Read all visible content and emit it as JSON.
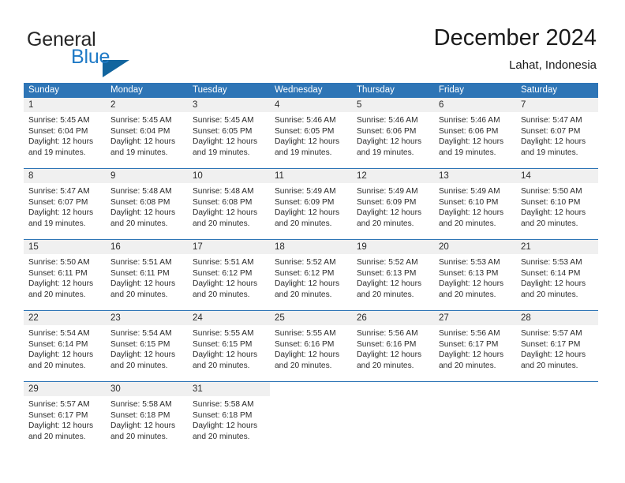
{
  "brand": {
    "name_part1": "General",
    "name_part2": "Blue",
    "accent_color": "#1f7ac6",
    "triangle_color": "#12659e"
  },
  "header": {
    "title": "December 2024",
    "location": "Lahat, Indonesia"
  },
  "colors": {
    "header_blue": "#2e75b6",
    "daynum_band": "#f0f0f0",
    "text": "#2b2b2b"
  },
  "weekdays": [
    "Sunday",
    "Monday",
    "Tuesday",
    "Wednesday",
    "Thursday",
    "Friday",
    "Saturday"
  ],
  "weeks": [
    [
      {
        "day": "1",
        "sunrise": "Sunrise: 5:45 AM",
        "sunset": "Sunset: 6:04 PM",
        "daylight1": "Daylight: 12 hours",
        "daylight2": "and 19 minutes."
      },
      {
        "day": "2",
        "sunrise": "Sunrise: 5:45 AM",
        "sunset": "Sunset: 6:04 PM",
        "daylight1": "Daylight: 12 hours",
        "daylight2": "and 19 minutes."
      },
      {
        "day": "3",
        "sunrise": "Sunrise: 5:45 AM",
        "sunset": "Sunset: 6:05 PM",
        "daylight1": "Daylight: 12 hours",
        "daylight2": "and 19 minutes."
      },
      {
        "day": "4",
        "sunrise": "Sunrise: 5:46 AM",
        "sunset": "Sunset: 6:05 PM",
        "daylight1": "Daylight: 12 hours",
        "daylight2": "and 19 minutes."
      },
      {
        "day": "5",
        "sunrise": "Sunrise: 5:46 AM",
        "sunset": "Sunset: 6:06 PM",
        "daylight1": "Daylight: 12 hours",
        "daylight2": "and 19 minutes."
      },
      {
        "day": "6",
        "sunrise": "Sunrise: 5:46 AM",
        "sunset": "Sunset: 6:06 PM",
        "daylight1": "Daylight: 12 hours",
        "daylight2": "and 19 minutes."
      },
      {
        "day": "7",
        "sunrise": "Sunrise: 5:47 AM",
        "sunset": "Sunset: 6:07 PM",
        "daylight1": "Daylight: 12 hours",
        "daylight2": "and 19 minutes."
      }
    ],
    [
      {
        "day": "8",
        "sunrise": "Sunrise: 5:47 AM",
        "sunset": "Sunset: 6:07 PM",
        "daylight1": "Daylight: 12 hours",
        "daylight2": "and 19 minutes."
      },
      {
        "day": "9",
        "sunrise": "Sunrise: 5:48 AM",
        "sunset": "Sunset: 6:08 PM",
        "daylight1": "Daylight: 12 hours",
        "daylight2": "and 20 minutes."
      },
      {
        "day": "10",
        "sunrise": "Sunrise: 5:48 AM",
        "sunset": "Sunset: 6:08 PM",
        "daylight1": "Daylight: 12 hours",
        "daylight2": "and 20 minutes."
      },
      {
        "day": "11",
        "sunrise": "Sunrise: 5:49 AM",
        "sunset": "Sunset: 6:09 PM",
        "daylight1": "Daylight: 12 hours",
        "daylight2": "and 20 minutes."
      },
      {
        "day": "12",
        "sunrise": "Sunrise: 5:49 AM",
        "sunset": "Sunset: 6:09 PM",
        "daylight1": "Daylight: 12 hours",
        "daylight2": "and 20 minutes."
      },
      {
        "day": "13",
        "sunrise": "Sunrise: 5:49 AM",
        "sunset": "Sunset: 6:10 PM",
        "daylight1": "Daylight: 12 hours",
        "daylight2": "and 20 minutes."
      },
      {
        "day": "14",
        "sunrise": "Sunrise: 5:50 AM",
        "sunset": "Sunset: 6:10 PM",
        "daylight1": "Daylight: 12 hours",
        "daylight2": "and 20 minutes."
      }
    ],
    [
      {
        "day": "15",
        "sunrise": "Sunrise: 5:50 AM",
        "sunset": "Sunset: 6:11 PM",
        "daylight1": "Daylight: 12 hours",
        "daylight2": "and 20 minutes."
      },
      {
        "day": "16",
        "sunrise": "Sunrise: 5:51 AM",
        "sunset": "Sunset: 6:11 PM",
        "daylight1": "Daylight: 12 hours",
        "daylight2": "and 20 minutes."
      },
      {
        "day": "17",
        "sunrise": "Sunrise: 5:51 AM",
        "sunset": "Sunset: 6:12 PM",
        "daylight1": "Daylight: 12 hours",
        "daylight2": "and 20 minutes."
      },
      {
        "day": "18",
        "sunrise": "Sunrise: 5:52 AM",
        "sunset": "Sunset: 6:12 PM",
        "daylight1": "Daylight: 12 hours",
        "daylight2": "and 20 minutes."
      },
      {
        "day": "19",
        "sunrise": "Sunrise: 5:52 AM",
        "sunset": "Sunset: 6:13 PM",
        "daylight1": "Daylight: 12 hours",
        "daylight2": "and 20 minutes."
      },
      {
        "day": "20",
        "sunrise": "Sunrise: 5:53 AM",
        "sunset": "Sunset: 6:13 PM",
        "daylight1": "Daylight: 12 hours",
        "daylight2": "and 20 minutes."
      },
      {
        "day": "21",
        "sunrise": "Sunrise: 5:53 AM",
        "sunset": "Sunset: 6:14 PM",
        "daylight1": "Daylight: 12 hours",
        "daylight2": "and 20 minutes."
      }
    ],
    [
      {
        "day": "22",
        "sunrise": "Sunrise: 5:54 AM",
        "sunset": "Sunset: 6:14 PM",
        "daylight1": "Daylight: 12 hours",
        "daylight2": "and 20 minutes."
      },
      {
        "day": "23",
        "sunrise": "Sunrise: 5:54 AM",
        "sunset": "Sunset: 6:15 PM",
        "daylight1": "Daylight: 12 hours",
        "daylight2": "and 20 minutes."
      },
      {
        "day": "24",
        "sunrise": "Sunrise: 5:55 AM",
        "sunset": "Sunset: 6:15 PM",
        "daylight1": "Daylight: 12 hours",
        "daylight2": "and 20 minutes."
      },
      {
        "day": "25",
        "sunrise": "Sunrise: 5:55 AM",
        "sunset": "Sunset: 6:16 PM",
        "daylight1": "Daylight: 12 hours",
        "daylight2": "and 20 minutes."
      },
      {
        "day": "26",
        "sunrise": "Sunrise: 5:56 AM",
        "sunset": "Sunset: 6:16 PM",
        "daylight1": "Daylight: 12 hours",
        "daylight2": "and 20 minutes."
      },
      {
        "day": "27",
        "sunrise": "Sunrise: 5:56 AM",
        "sunset": "Sunset: 6:17 PM",
        "daylight1": "Daylight: 12 hours",
        "daylight2": "and 20 minutes."
      },
      {
        "day": "28",
        "sunrise": "Sunrise: 5:57 AM",
        "sunset": "Sunset: 6:17 PM",
        "daylight1": "Daylight: 12 hours",
        "daylight2": "and 20 minutes."
      }
    ],
    [
      {
        "day": "29",
        "sunrise": "Sunrise: 5:57 AM",
        "sunset": "Sunset: 6:17 PM",
        "daylight1": "Daylight: 12 hours",
        "daylight2": "and 20 minutes."
      },
      {
        "day": "30",
        "sunrise": "Sunrise: 5:58 AM",
        "sunset": "Sunset: 6:18 PM",
        "daylight1": "Daylight: 12 hours",
        "daylight2": "and 20 minutes."
      },
      {
        "day": "31",
        "sunrise": "Sunrise: 5:58 AM",
        "sunset": "Sunset: 6:18 PM",
        "daylight1": "Daylight: 12 hours",
        "daylight2": "and 20 minutes."
      },
      null,
      null,
      null,
      null
    ]
  ]
}
